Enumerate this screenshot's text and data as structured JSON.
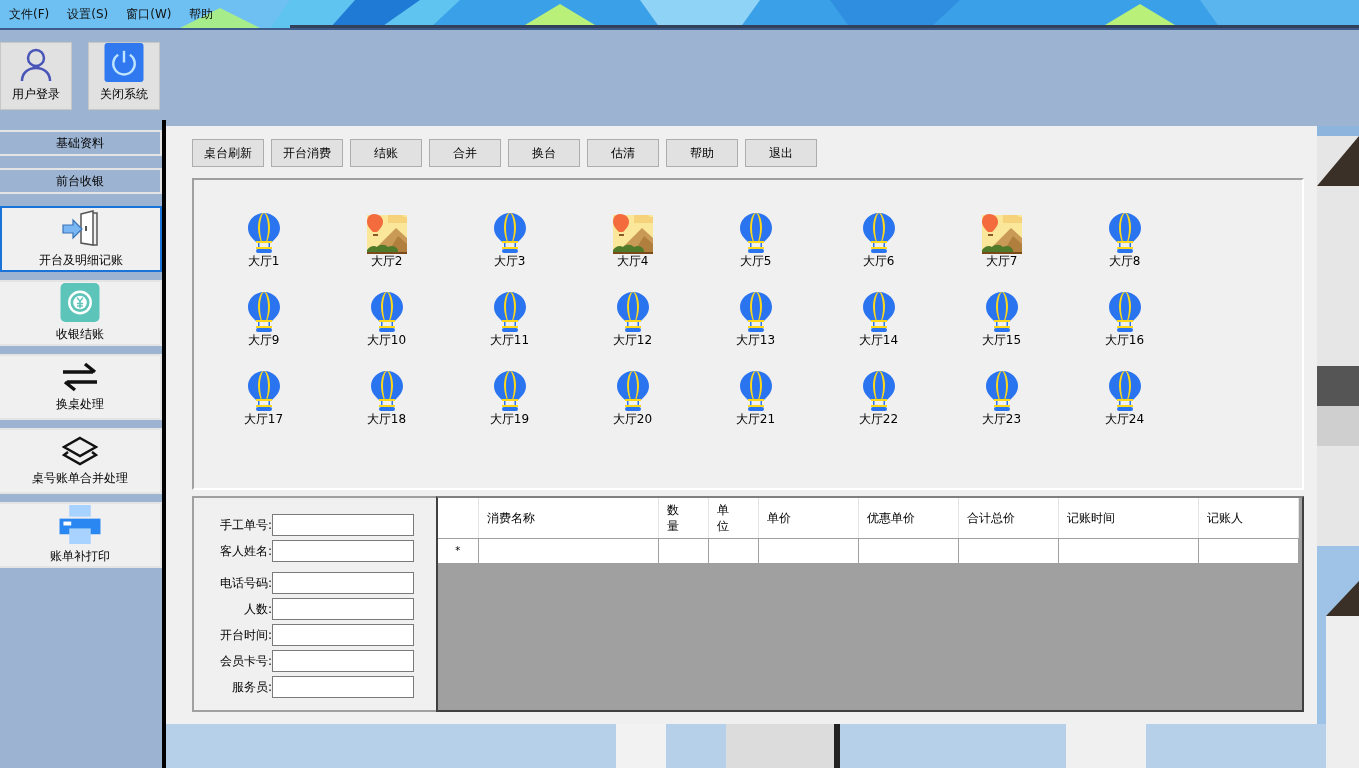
{
  "menu": [
    {
      "label": "文件(F)"
    },
    {
      "label": "设置(S)"
    },
    {
      "label": "窗口(W)"
    },
    {
      "label": "帮助"
    }
  ],
  "toolbar": [
    {
      "label": "用户登录"
    },
    {
      "label": "关闭系统"
    }
  ],
  "sidebar": {
    "groups": [
      {
        "label": "基础资料"
      },
      {
        "label": "前台收银"
      }
    ],
    "items": [
      {
        "label": "开台及明细记账",
        "selected": true
      },
      {
        "label": "收银结账",
        "selected": false
      },
      {
        "label": "换桌处理",
        "selected": false
      },
      {
        "label": "桌号账单合并处理",
        "selected": false
      },
      {
        "label": "账单补打印",
        "selected": false
      }
    ]
  },
  "actions": [
    "桌台刷新",
    "开台消费",
    "结账",
    "合并",
    "换台",
    "估清",
    "帮助",
    "退出"
  ],
  "tables": [
    {
      "name": "大厅1",
      "occupied": false
    },
    {
      "name": "大厅2",
      "occupied": true
    },
    {
      "name": "大厅3",
      "occupied": false
    },
    {
      "name": "大厅4",
      "occupied": true
    },
    {
      "name": "大厅5",
      "occupied": false
    },
    {
      "name": "大厅6",
      "occupied": false
    },
    {
      "name": "大厅7",
      "occupied": true
    },
    {
      "name": "大厅8",
      "occupied": false
    },
    {
      "name": "大厅9",
      "occupied": false
    },
    {
      "name": "大厅10",
      "occupied": false
    },
    {
      "name": "大厅11",
      "occupied": false
    },
    {
      "name": "大厅12",
      "occupied": false
    },
    {
      "name": "大厅13",
      "occupied": false
    },
    {
      "name": "大厅14",
      "occupied": false
    },
    {
      "name": "大厅15",
      "occupied": false
    },
    {
      "name": "大厅16",
      "occupied": false
    },
    {
      "name": "大厅17",
      "occupied": false
    },
    {
      "name": "大厅18",
      "occupied": false
    },
    {
      "name": "大厅19",
      "occupied": false
    },
    {
      "name": "大厅20",
      "occupied": false
    },
    {
      "name": "大厅21",
      "occupied": false
    },
    {
      "name": "大厅22",
      "occupied": false
    },
    {
      "name": "大厅23",
      "occupied": false
    },
    {
      "name": "大厅24",
      "occupied": false
    }
  ],
  "form": [
    {
      "label": "手工单号:"
    },
    {
      "label": "客人姓名:"
    },
    {
      "label": "电话号码:"
    },
    {
      "label": "人数:"
    },
    {
      "label": "开台时间:"
    },
    {
      "label": "会员卡号:"
    },
    {
      "label": "服务员:"
    }
  ],
  "grid": {
    "columns": [
      "消费名称",
      "数量",
      "单位",
      "单价",
      "优惠单价",
      "合计总价",
      "记账时间",
      "记账人"
    ],
    "new_row_marker": "*"
  }
}
